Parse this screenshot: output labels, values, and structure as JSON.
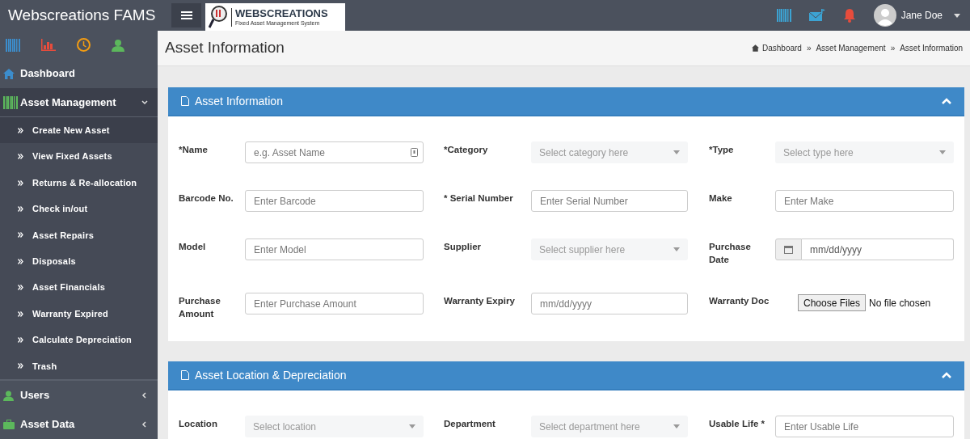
{
  "app": {
    "title": "Webscreations FAMS",
    "logo_title": "WEBSCREATIONS",
    "logo_subtitle": "Fixed Asset Management System"
  },
  "user": {
    "name": "Jane Doe"
  },
  "sidebar": {
    "items": [
      {
        "label": "Dashboard",
        "expanded": false
      },
      {
        "label": "Asset Management",
        "expanded": true,
        "children": [
          {
            "label": "Create New Asset",
            "selected": true
          },
          {
            "label": "View Fixed Assets",
            "selected": false
          },
          {
            "label": "Returns & Re-allocation",
            "selected": false
          },
          {
            "label": "Check in/out",
            "selected": false
          },
          {
            "label": "Asset Repairs",
            "selected": false
          },
          {
            "label": "Disposals",
            "selected": false
          },
          {
            "label": "Asset Financials",
            "selected": false
          },
          {
            "label": "Warranty Expired",
            "selected": false
          },
          {
            "label": "Calculate Depreciation",
            "selected": false
          },
          {
            "label": "Trash",
            "selected": false
          }
        ]
      },
      {
        "label": "Users",
        "expanded": false
      },
      {
        "label": "Asset Data",
        "expanded": false
      }
    ]
  },
  "page": {
    "title": "Asset Information",
    "breadcrumb": [
      "Dashboard",
      "Asset Management",
      "Asset Information"
    ],
    "separator": "»"
  },
  "panels": [
    {
      "title": "Asset Information",
      "expanded": true,
      "fields": [
        {
          "label": "*Name",
          "kind": "text",
          "placeholder": "e.g. Asset Name",
          "badge": true
        },
        {
          "label": "*Category",
          "kind": "select",
          "placeholder": "Select category here"
        },
        {
          "label": "*Type",
          "kind": "select",
          "placeholder": "Select type here"
        },
        {
          "label": "Barcode No.",
          "kind": "text",
          "placeholder": "Enter Barcode"
        },
        {
          "label": "* Serial Number",
          "kind": "text",
          "placeholder": "Enter Serial Number"
        },
        {
          "label": "Make",
          "kind": "text",
          "placeholder": "Enter Make"
        },
        {
          "label": "Model",
          "kind": "text",
          "placeholder": "Enter Model"
        },
        {
          "label": "Supplier",
          "kind": "select",
          "placeholder": "Select supplier here"
        },
        {
          "label": "Purchase Date",
          "kind": "date",
          "placeholder": "mm/dd/yyyy"
        },
        {
          "label": "Purchase Amount",
          "kind": "text",
          "placeholder": "Enter Purchase Amount"
        },
        {
          "label": "Warranty Expiry",
          "kind": "text",
          "placeholder": "mm/dd/yyyy"
        },
        {
          "label": "Warranty Doc",
          "kind": "file",
          "button": "Choose Files",
          "status": "No file chosen"
        }
      ]
    },
    {
      "title": "Asset Location & Depreciation",
      "expanded": true,
      "fields": [
        {
          "label": "Location",
          "kind": "select",
          "placeholder": "Select location"
        },
        {
          "label": "Department",
          "kind": "select",
          "placeholder": "Select department here"
        },
        {
          "label": "Usable Life *",
          "kind": "text",
          "placeholder": "Enter Usable Life"
        }
      ]
    }
  ]
}
